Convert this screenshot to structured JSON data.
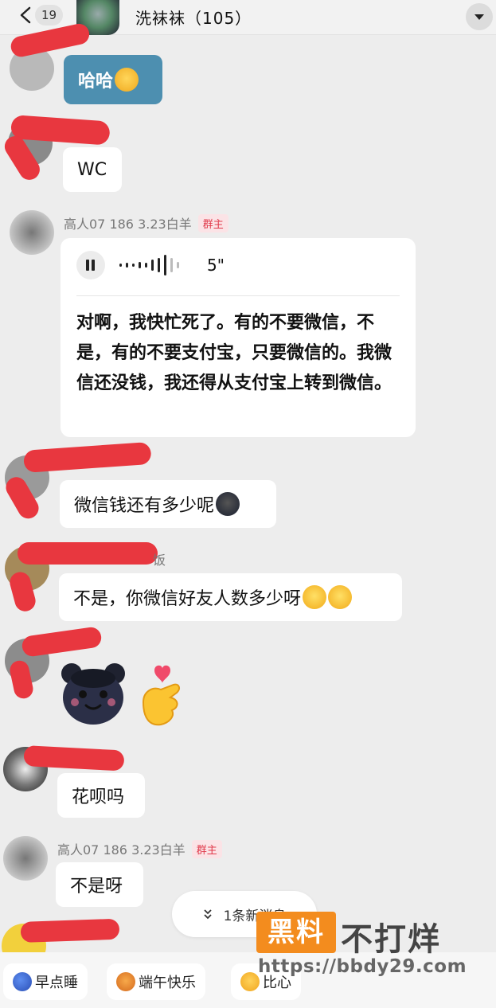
{
  "header": {
    "unread_count": "19",
    "title": "洗袜袜（105）"
  },
  "messages": {
    "m1_text": "哈哈",
    "m2_text": "WC",
    "m3_sender": "高人07 186 3.23白羊",
    "m3_role": "群主",
    "m3_voice_duration": "5\"",
    "m3_transcript": "对啊，我快忙死了。有的不要微信，不是，有的不要支付宝，只要微信的。我微信还没钱，我还得从支付宝上转到微信。",
    "m4_text": "微信钱还有多少呢",
    "m5_sender_fragment": "饭",
    "m5_text": "不是，你微信好友人数多少呀",
    "m7_text": "花呗吗",
    "m8_sender": "高人07 186 3.23白羊",
    "m8_role": "群主",
    "m8_text": "不是呀"
  },
  "new_message_pill": "1条新消息",
  "quick_replies": [
    "早点睡",
    "端午快乐",
    "比心"
  ],
  "watermark": {
    "box_text": "黑料",
    "text": "不打烊",
    "url": "https://bbdy29.com"
  },
  "colors": {
    "background": "#ededed",
    "bubble": "#ffffff",
    "blue_bubble": "#4d8fb0",
    "redaction": "#e8373f",
    "owner_tag": "#e0394a",
    "watermark_orange": "#f38c1e"
  },
  "icons": [
    "back-chevron-icon",
    "dropdown-arrow-icon",
    "pause-icon",
    "double-chevron-down-icon",
    "emoji-icon",
    "sticker-icon"
  ]
}
